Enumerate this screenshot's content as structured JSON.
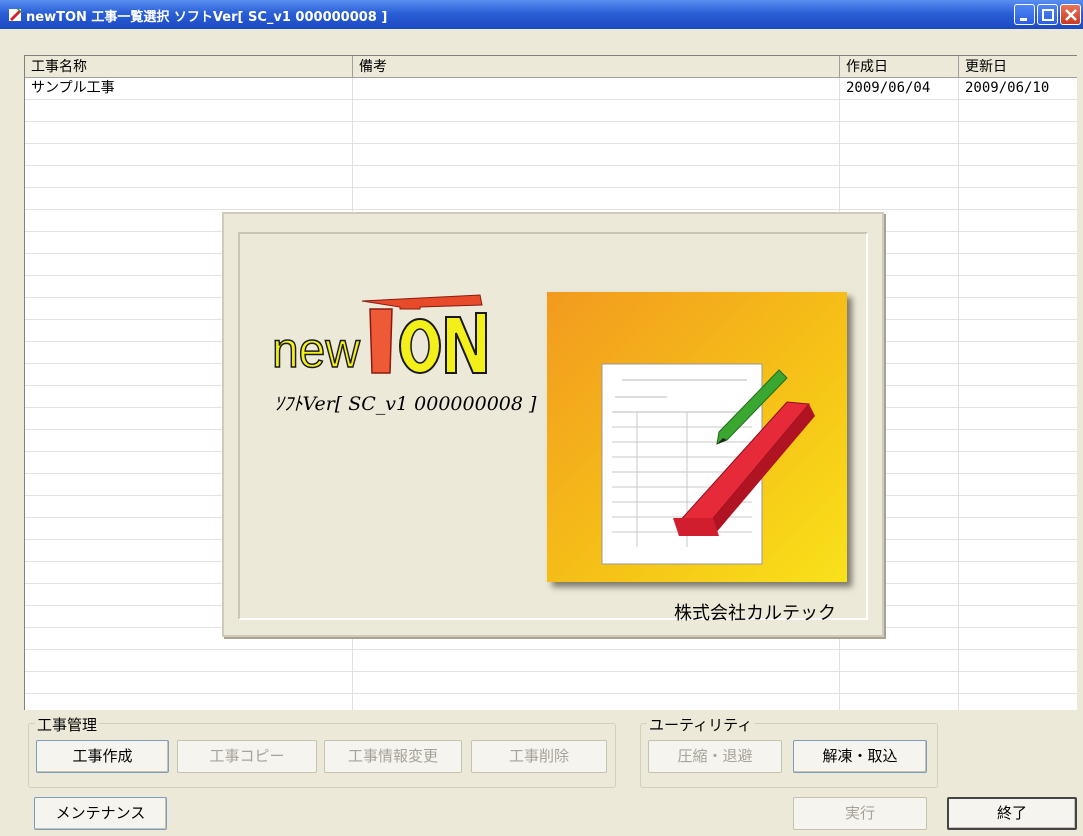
{
  "window": {
    "title": "newTON 工事一覧選択 ソフトVer[ SC_v1 000000008 ]",
    "icon": "app-icon",
    "controls": [
      "minimize-icon",
      "maximize-icon",
      "close-icon"
    ]
  },
  "list": {
    "columns": [
      "工事名称",
      "備考",
      "作成日",
      "更新日"
    ],
    "rows": [
      {
        "name": "サンプル工事",
        "note": "",
        "created": "2009/06/04",
        "updated": "2009/06/10"
      }
    ]
  },
  "splash": {
    "logo_text": "newTON",
    "version_text": "ｿﾌﾄVer[ SC_v1 000000008 ]",
    "company": "株式会社カルテック"
  },
  "groups": {
    "project": {
      "label": "工事管理",
      "buttons": [
        "工事作成",
        "工事コピー",
        "工事情報変更",
        "工事削除"
      ]
    },
    "utility": {
      "label": "ユーティリティ",
      "buttons": [
        "圧縮・退避",
        "解凍・取込"
      ]
    }
  },
  "footer": {
    "maintenance": "メンテナンス",
    "execute": "実行",
    "exit": "終了"
  },
  "colors": {
    "titlebar": "#2a5fd6",
    "face": "#ece9d8",
    "close": "#c9391f"
  }
}
